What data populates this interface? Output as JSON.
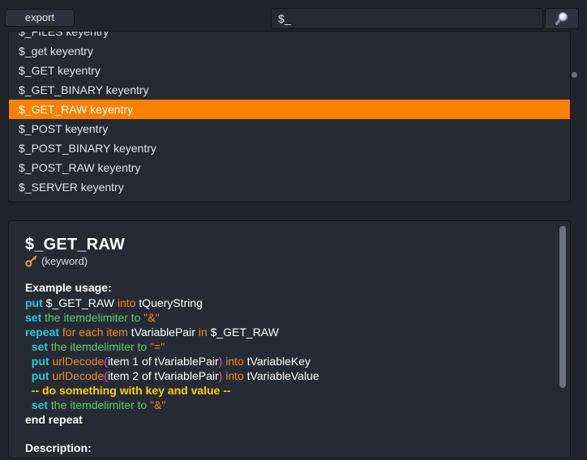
{
  "toolbar": {
    "export_label": "export",
    "search_value": "$_",
    "search_placeholder": "",
    "search_icon": "magnifier-icon"
  },
  "results": {
    "items": [
      {
        "label": "$_FILES keyentry",
        "selected": false
      },
      {
        "label": "$_get keyentry",
        "selected": false
      },
      {
        "label": "$_GET keyentry",
        "selected": false
      },
      {
        "label": "$_GET_BINARY keyentry",
        "selected": false
      },
      {
        "label": "$_GET_RAW keyentry",
        "selected": true
      },
      {
        "label": "$_POST keyentry",
        "selected": false
      },
      {
        "label": "$_POST_BINARY keyentry",
        "selected": false
      },
      {
        "label": "$_POST_RAW keyentry",
        "selected": false
      },
      {
        "label": "$_SERVER keyentry",
        "selected": false
      }
    ]
  },
  "detail": {
    "title": "$_GET_RAW",
    "type_icon": "key-icon",
    "type_label": "(keyword)",
    "example_label": "Example usage:",
    "description_label": "Description:",
    "code_lines": [
      [
        {
          "t": "put ",
          "c": "tk"
        },
        {
          "t": "$_GET_RAW ",
          "c": "tp"
        },
        {
          "t": "into ",
          "c": "to"
        },
        {
          "t": "tQueryString",
          "c": "tp"
        }
      ],
      [
        {
          "t": "set ",
          "c": "tk"
        },
        {
          "t": "the itemdelimiter ",
          "c": "tg"
        },
        {
          "t": "to ",
          "c": "tg"
        },
        {
          "t": "\"&\"",
          "c": "ts"
        }
      ],
      [
        {
          "t": "repeat ",
          "c": "tk"
        },
        {
          "t": "for each item ",
          "c": "to"
        },
        {
          "t": "tVariablePair ",
          "c": "tp"
        },
        {
          "t": "in ",
          "c": "to"
        },
        {
          "t": "$_GET_RAW",
          "c": "tp"
        }
      ],
      [
        {
          "t": "  set ",
          "c": "tk"
        },
        {
          "t": "the itemdelimiter ",
          "c": "tg"
        },
        {
          "t": "to ",
          "c": "tg"
        },
        {
          "t": "\"=\"",
          "c": "ts"
        }
      ],
      [
        {
          "t": "  put ",
          "c": "tk"
        },
        {
          "t": "urlDecode",
          "c": "tf"
        },
        {
          "t": "(",
          "c": "tm"
        },
        {
          "t": "item 1 of tVariablePair",
          "c": "tp"
        },
        {
          "t": ")",
          "c": "tm"
        },
        {
          "t": " into ",
          "c": "to"
        },
        {
          "t": "tVariableKey",
          "c": "tp"
        }
      ],
      [
        {
          "t": "  put ",
          "c": "tk"
        },
        {
          "t": "urlDecode",
          "c": "tf"
        },
        {
          "t": "(",
          "c": "tm"
        },
        {
          "t": "item 2 of tVariablePair",
          "c": "tp"
        },
        {
          "t": ")",
          "c": "tm"
        },
        {
          "t": " into ",
          "c": "to"
        },
        {
          "t": "tVariableValue",
          "c": "tp"
        }
      ],
      [
        {
          "t": "  -- do something with key and value --",
          "c": "tc"
        }
      ],
      [
        {
          "t": "  set ",
          "c": "tk"
        },
        {
          "t": "the itemdelimiter ",
          "c": "tg"
        },
        {
          "t": "to ",
          "c": "tg"
        },
        {
          "t": "\"&\"",
          "c": "ts"
        }
      ],
      [
        {
          "t": "end repeat",
          "c": "tkw"
        }
      ]
    ]
  },
  "colors": {
    "page_background": "#21242d",
    "panel_background": "#262a34",
    "selection_orange": "#fc8000",
    "keyword_cyan": "#2ec8d8",
    "operator_orange": "#f28c28",
    "identifier_green": "#5fcf6b",
    "comment_yellow": "#ffd000",
    "paren_magenta": "#e255c8",
    "scrollbar_grey": "#6d7280"
  }
}
